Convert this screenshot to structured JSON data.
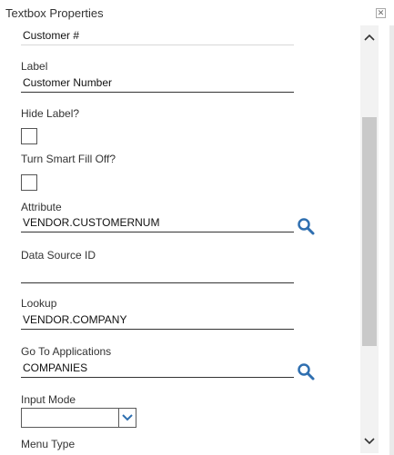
{
  "dialog": {
    "title": "Textbox Properties",
    "close_icon": "close-icon"
  },
  "top_field": {
    "value": "Customer #"
  },
  "label": {
    "label": "Label",
    "value": "Customer Number"
  },
  "hide_label": {
    "label": "Hide Label?",
    "checked": false
  },
  "smart_fill": {
    "label": "Turn Smart Fill Off?",
    "checked": false
  },
  "attribute": {
    "label": "Attribute",
    "value": "VENDOR.CUSTOMERNUM",
    "icon": "search-icon"
  },
  "data_source": {
    "label": "Data Source ID",
    "value": ""
  },
  "lookup": {
    "label": "Lookup",
    "value": "VENDOR.COMPANY"
  },
  "go_to_apps": {
    "label": "Go To Applications",
    "value": "COMPANIES",
    "icon": "search-icon"
  },
  "input_mode": {
    "label": "Input Mode",
    "value": ""
  },
  "menu_type": {
    "label": "Menu Type"
  },
  "colors": {
    "accent": "#2f6fb0",
    "text": "#333333",
    "scroll_thumb": "#c9c9c9"
  }
}
